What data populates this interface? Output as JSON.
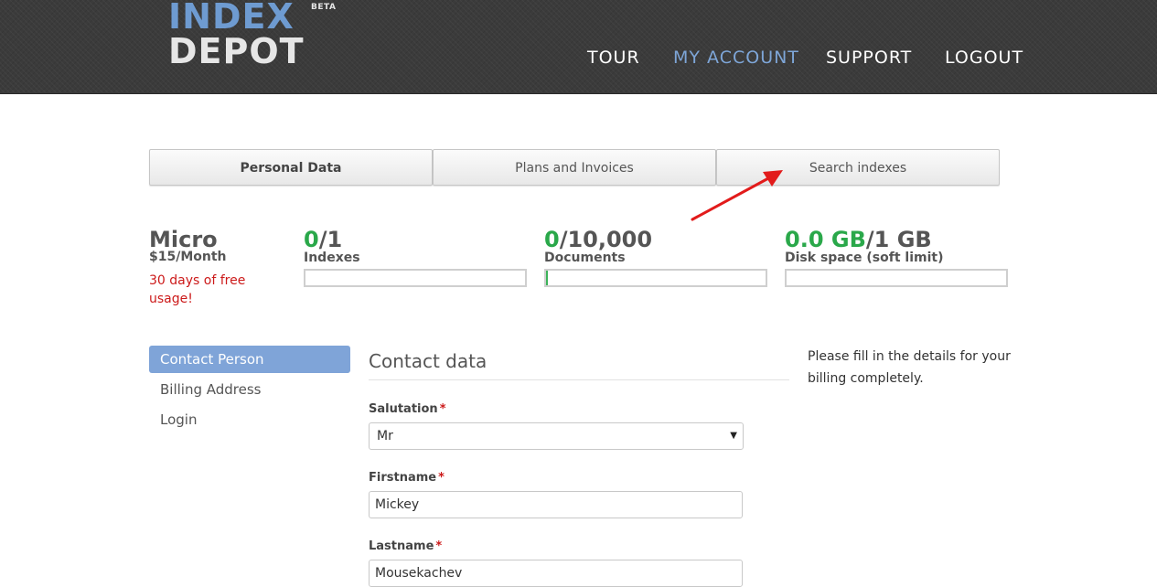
{
  "logo": {
    "line1": "INDEX",
    "line2": "DEPOT",
    "badge": "BETA"
  },
  "nav": {
    "tour": "TOUR",
    "account": "MY ACCOUNT",
    "support": "SUPPORT",
    "logout": "LOGOUT",
    "active": "MY ACCOUNT"
  },
  "tabs": [
    {
      "label": "Personal Data",
      "active": true
    },
    {
      "label": "Plans and Invoices",
      "active": false
    },
    {
      "label": "Search indexes",
      "active": false
    }
  ],
  "plan": {
    "name": "Micro",
    "price": "$15/Month",
    "free_note": "30 days of free usage!"
  },
  "stats": [
    {
      "used": "0",
      "total": "/1",
      "label": "Indexes",
      "fraction": 0.0
    },
    {
      "used": "0",
      "total": "/10,000",
      "label": "Documents",
      "fraction": 0.01
    },
    {
      "used": "0.0 GB",
      "total": "/1 GB",
      "label": "Disk space (soft limit)",
      "fraction": 0.0
    }
  ],
  "sidebar": {
    "items": [
      {
        "label": "Contact Person",
        "active": true
      },
      {
        "label": "Billing Address",
        "active": false
      },
      {
        "label": "Login",
        "active": false
      }
    ]
  },
  "form": {
    "title": "Contact data",
    "required_mark": "*",
    "salutation": {
      "label": "Salutation",
      "value": "Mr",
      "caret": "▼"
    },
    "firstname": {
      "label": "Firstname",
      "value": "Mickey"
    },
    "lastname": {
      "label": "Lastname",
      "value": "Mousekachev"
    }
  },
  "help": {
    "text": "Please fill in the details for your billing completely."
  },
  "colors": {
    "accent": "#7fa4d8",
    "used_green": "#2aa84a",
    "warning_red": "#cc1a1a",
    "annotation_arrow": "#e21b1b"
  }
}
